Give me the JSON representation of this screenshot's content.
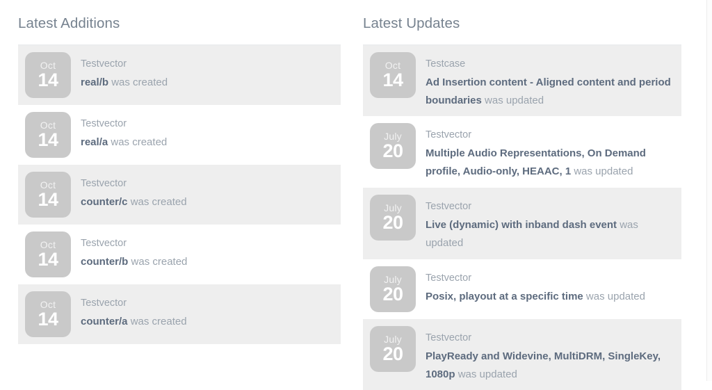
{
  "columns": [
    {
      "title": "Latest Additions",
      "items": [
        {
          "month": "Oct",
          "day": "14",
          "kind": "Testvector",
          "link": "real/b",
          "action": "was created",
          "striped": true
        },
        {
          "month": "Oct",
          "day": "14",
          "kind": "Testvector",
          "link": "real/a",
          "action": "was created",
          "striped": false
        },
        {
          "month": "Oct",
          "day": "14",
          "kind": "Testvector",
          "link": "counter/c",
          "action": "was created",
          "striped": true
        },
        {
          "month": "Oct",
          "day": "14",
          "kind": "Testvector",
          "link": "counter/b",
          "action": "was created",
          "striped": false
        },
        {
          "month": "Oct",
          "day": "14",
          "kind": "Testvector",
          "link": "counter/a",
          "action": "was created",
          "striped": true
        }
      ]
    },
    {
      "title": "Latest Updates",
      "items": [
        {
          "month": "Oct",
          "day": "14",
          "kind": "Testcase",
          "link": "Ad Insertion content - Aligned content and period boundaries",
          "action": "was updated",
          "striped": true
        },
        {
          "month": "July",
          "day": "20",
          "kind": "Testvector",
          "link": "Multiple Audio Representations, On Demand profile, Audio-only, HEAAC, 1",
          "action": "was updated",
          "striped": false
        },
        {
          "month": "July",
          "day": "20",
          "kind": "Testvector",
          "link": "Live (dynamic) with inband dash event",
          "action": "was updated",
          "striped": true
        },
        {
          "month": "July",
          "day": "20",
          "kind": "Testvector",
          "link": "Posix, playout at a specific time",
          "action": "was updated",
          "striped": false
        },
        {
          "month": "July",
          "day": "20",
          "kind": "Testvector",
          "link": "PlayReady and Widevine, MultiDRM, SingleKey, 1080p",
          "action": "was updated",
          "striped": true
        }
      ]
    }
  ],
  "colors": {
    "heading": "#76828f",
    "link": "#5d6b7e",
    "muted": "#9aa3ad",
    "badge": "#c9c9c9",
    "stripe": "#eeeeee",
    "rule": "#e7eaec"
  }
}
